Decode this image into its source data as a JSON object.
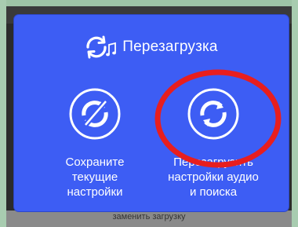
{
  "background": {
    "bottom_text": "заменить загрузку"
  },
  "dialog": {
    "title": "Перезагрузка",
    "title_icon": "restart-music-icon",
    "options": [
      {
        "name": "save",
        "icon": "sync-disabled-icon",
        "label_lines": [
          "Сохраните",
          "текущие",
          "настройки"
        ]
      },
      {
        "name": "reload",
        "icon": "sync-icon",
        "label_lines": [
          "Перезагрузить",
          "настройки аудио",
          "и поиска"
        ]
      }
    ]
  },
  "annotation": {
    "shape": "ellipse",
    "color": "#e81e1e",
    "target": "reload-option"
  },
  "colors": {
    "dialog_bg": "#3d5df4",
    "text": "#ffffff",
    "highlight": "#e81e1e"
  }
}
